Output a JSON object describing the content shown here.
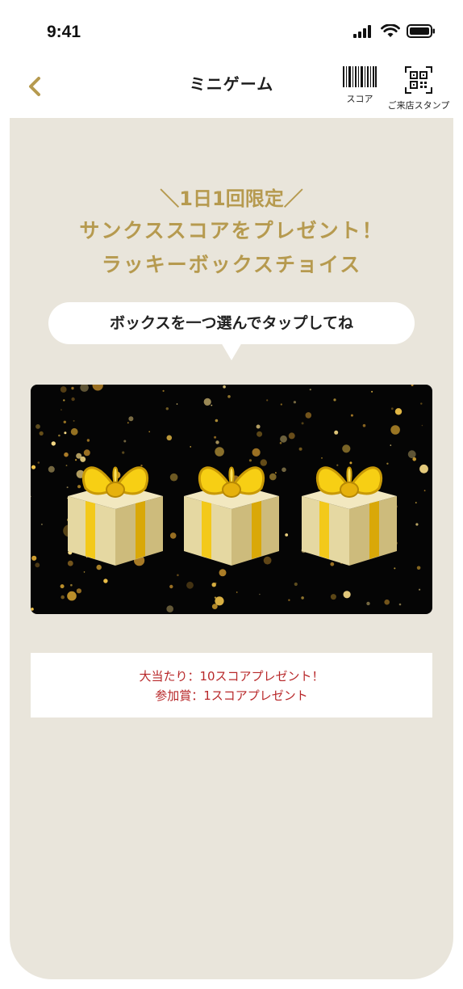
{
  "status_bar": {
    "time": "9:41",
    "icons": [
      "signal-icon",
      "wifi-icon",
      "battery-icon"
    ]
  },
  "header": {
    "back_icon": "chevron-left-icon",
    "title": "ミニゲーム",
    "score_label": "スコア",
    "score_icon": "barcode-icon",
    "stamp_label": "ご来店スタンプ",
    "stamp_icon": "qr-code-icon"
  },
  "campaign": {
    "line1": "＼1日1回限定／",
    "line2": "サンクススコアをプレゼント！",
    "line3": "ラッキーボックスチョイス"
  },
  "instruction": "ボックスを一つ選んでタップしてね",
  "gifts": [
    "gift-box-icon",
    "gift-box-icon",
    "gift-box-icon"
  ],
  "prizes": {
    "grand": "大当たり：10スコアプレゼント！",
    "participation": "参加賞：1スコアプレゼント"
  },
  "colors": {
    "accent_gold": "#b69a4f",
    "panel_bg": "#e9e5db",
    "prize_red": "#b8282a",
    "stage_bg": "#050505"
  }
}
